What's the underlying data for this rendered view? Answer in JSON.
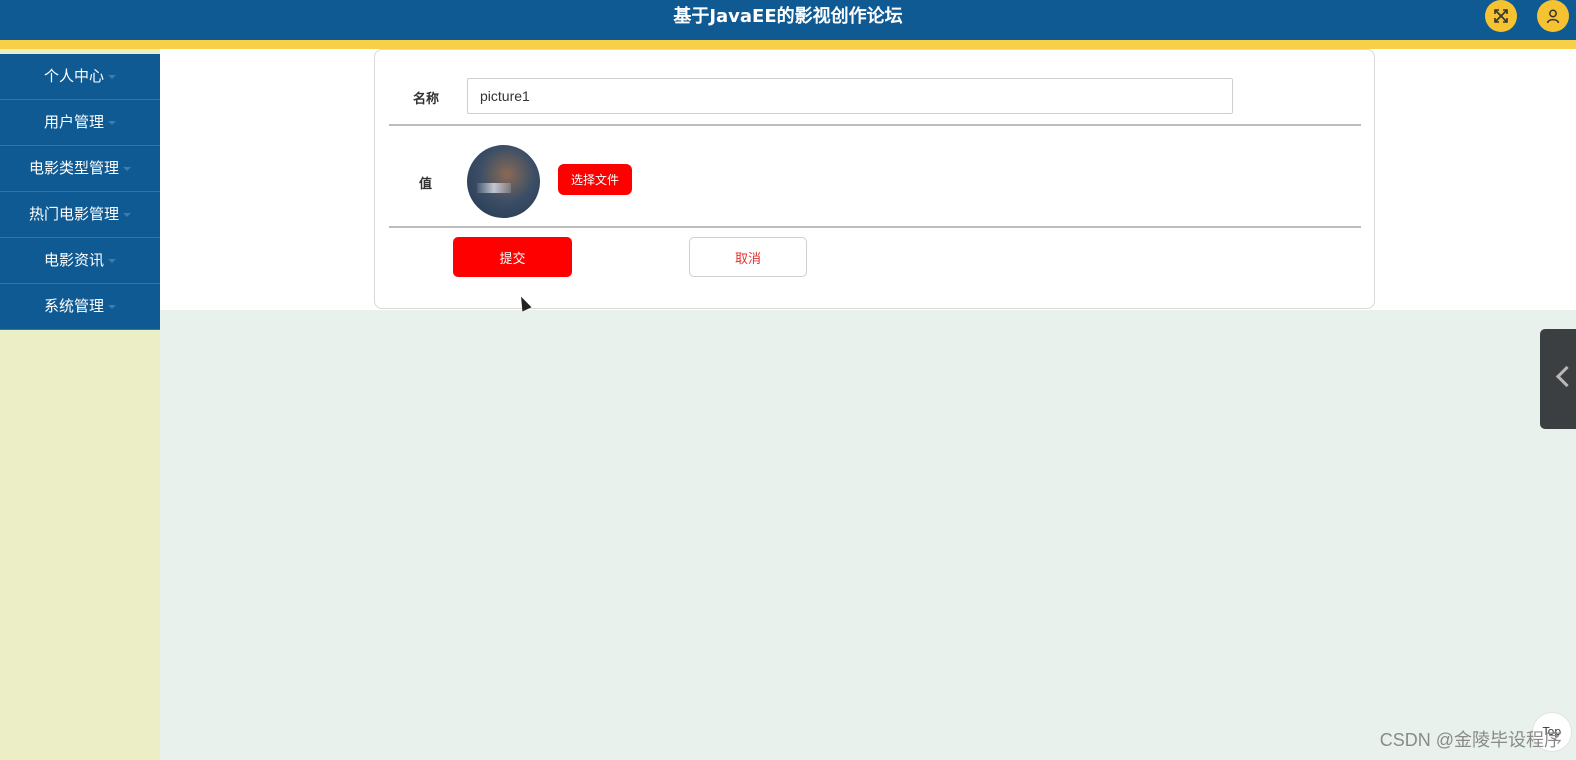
{
  "header": {
    "title": "基于JavaEE的影视创作论坛",
    "fullscreen_icon": "expand-icon",
    "user_icon": "user-icon"
  },
  "sidebar": {
    "items": [
      {
        "label": "个人中心"
      },
      {
        "label": "用户管理"
      },
      {
        "label": "电影类型管理"
      },
      {
        "label": "热门电影管理"
      },
      {
        "label": "电影资讯"
      },
      {
        "label": "系统管理"
      }
    ]
  },
  "form": {
    "name_label": "名称",
    "name_value": "picture1",
    "value_label": "值",
    "choose_file_label": "选择文件",
    "submit_label": "提交",
    "cancel_label": "取消"
  },
  "floating": {
    "top_label": "Top"
  },
  "watermark": "CSDN @金陵毕设程序",
  "colors": {
    "header_bg": "#105a93",
    "accent_stripe": "#f7cf48",
    "primary_button": "#ff0000",
    "sidebar_bg": "#eceec6",
    "content_bg": "#e8f1ec"
  }
}
